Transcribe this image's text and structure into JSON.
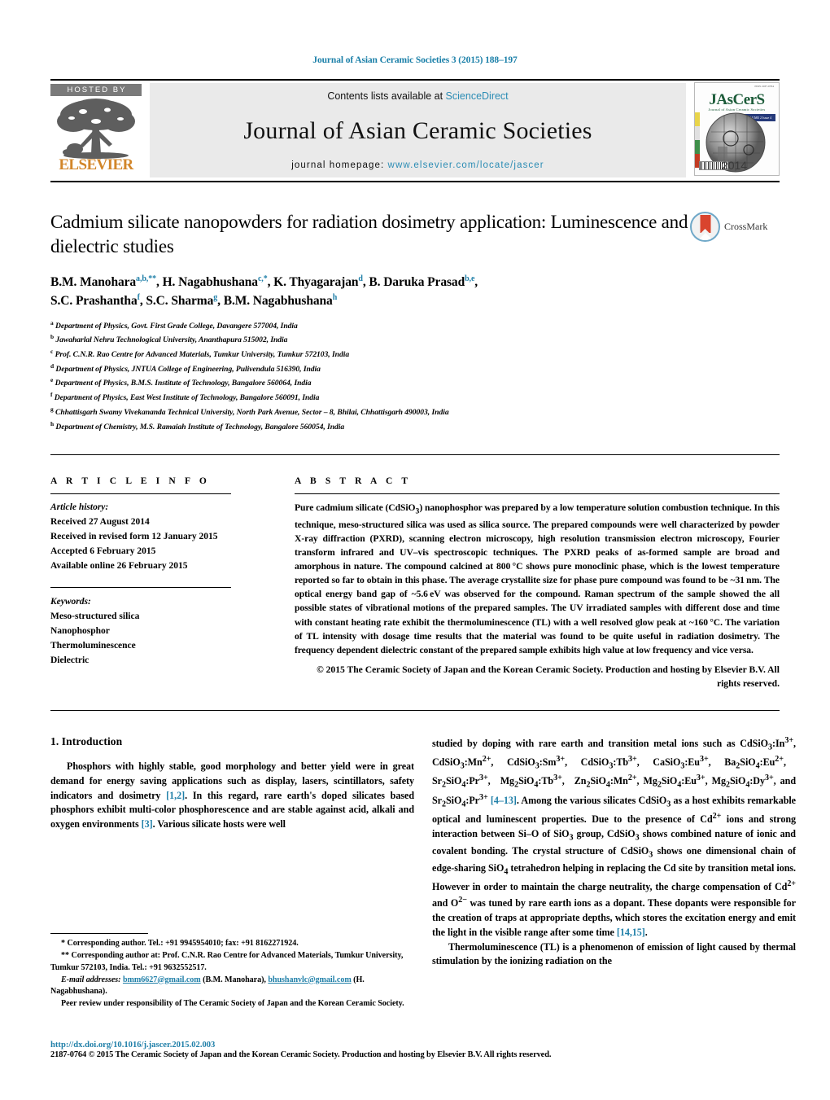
{
  "running_head": "Journal of Asian Ceramic Societies 3 (2015) 188–197",
  "masthead": {
    "hosted_by": "HOSTED BY",
    "publisher": "ELSEVIER",
    "contents_prefix": "Contents lists available at ",
    "contents_link": "ScienceDirect",
    "journal_name": "Journal of Asian Ceramic Societies",
    "homepage_prefix": "journal homepage: ",
    "homepage_url": "www.elsevier.com/locate/jascer",
    "cover": {
      "title": "JAsCerS",
      "subtitle": "Journal of Asian Ceramic Societies",
      "corner_note": "ISSN 2187-0764",
      "badge": "VOLUME 2 Issue 4",
      "year": "2014"
    }
  },
  "article": {
    "title": "Cadmium silicate nanopowders for radiation dosimetry application: Luminescence and dielectric studies",
    "crossmark_label": "CrossMark",
    "authors_line_1_html": "B.M. Manohara<sup>a,b,**</sup>, H. Nagabhushana<sup>c,*</sup>, K. Thyagarajan<sup>d</sup>, B. Daruka Prasad<sup>b,e</sup>,",
    "authors_line_2_html": "S.C. Prashantha<sup>f</sup>, S.C. Sharma<sup>g</sup>, B.M. Nagabhushana<sup>h</sup>",
    "affiliations": [
      {
        "mark": "a",
        "text": "Department of Physics, Govt. First Grade College, Davangere 577004, India"
      },
      {
        "mark": "b",
        "text": "Jawaharlal Nehru Technological University, Ananthapura 515002, India"
      },
      {
        "mark": "c",
        "text": "Prof. C.N.R. Rao Centre for Advanced Materials, Tumkur University, Tumkur 572103, India"
      },
      {
        "mark": "d",
        "text": "Department of Physics, JNTUA College of Engineering, Pulivendula 516390, India"
      },
      {
        "mark": "e",
        "text": "Department of Physics, B.M.S. Institute of Technology, Bangalore 560064, India"
      },
      {
        "mark": "f",
        "text": "Department of Physics, East West Institute of Technology, Bangalore 560091, India"
      },
      {
        "mark": "g",
        "text": "Chhattisgarh Swamy Vivekananda Technical University, North Park Avenue, Sector – 8, Bhilai, Chhattisgarh 490003, India"
      },
      {
        "mark": "h",
        "text": "Department of Chemistry, M.S. Ramaiah Institute of Technology, Bangalore 560054, India"
      }
    ]
  },
  "article_info": {
    "heading": "A R T I C L E   I N F O",
    "history_label": "Article history:",
    "history": [
      "Received 27 August 2014",
      "Received in revised form 12 January 2015",
      "Accepted 6 February 2015",
      "Available online 26 February 2015"
    ],
    "keywords_label": "Keywords:",
    "keywords": [
      "Meso-structured silica",
      "Nanophosphor",
      "Thermoluminescence",
      "Dielectric"
    ]
  },
  "abstract": {
    "heading": "A B S T R A C T",
    "body_html": "Pure cadmium silicate (CdSiO<sub>3</sub>) nanophosphor was prepared by a low temperature solution combustion technique. In this technique, meso-structured silica was used as silica source. The prepared compounds were well characterized by powder X-ray diffraction (PXRD), scanning electron microscopy, high resolution transmission electron microscopy, Fourier transform infrared and UV–vis spectroscopic techniques. The PXRD peaks of as-formed sample are broad and amorphous in nature. The compound calcined at 800&#8201;°C shows pure monoclinic phase, which is the lowest temperature reported so far to obtain in this phase. The average crystallite size for phase pure compound was found to be ~31&#8201;nm. The optical energy band gap of ~5.6&#8201;eV was observed for the compound. Raman spectrum of the sample showed the all possible states of vibrational motions of the prepared samples. The UV irradiated samples with different dose and time with constant heating rate exhibit the thermoluminescence (TL) with a well resolved glow peak at ~160&#8201;°C. The variation of TL intensity with dosage time results that the material was found to be quite useful in radiation dosimetry. The frequency dependent dielectric constant of the prepared sample exhibits high value at low frequency and vice versa.",
    "copyright": "© 2015 The Ceramic Society of Japan and the Korean Ceramic Society. Production and hosting by Elsevier B.V. All rights reserved."
  },
  "introduction": {
    "heading": "1.  Introduction",
    "left_para_html": "Phosphors with highly stable, good morphology and better yield were in great demand for energy saving applications such as display, lasers, scintillators, safety indicators and dosimetry <span class=\"ref\">[1,2]</span>. In this regard, rare earth's doped silicates based phosphors exhibit multi-color phosphorescence and are stable against acid, alkali and oxygen environments <span class=\"ref\">[3]</span>. Various silicate hosts were well",
    "right_para_1_html": "studied by doping with rare earth and transition metal ions such as CdSiO<sub>3</sub>:In<sup>3+</sup>, CdSiO<sub>3</sub>:Mn<sup>2+</sup>, CdSiO<sub>3</sub>:Sm<sup>3+</sup>, CdSiO<sub>3</sub>:Tb<sup>3+</sup>, CaSiO<sub>3</sub>:Eu<sup>3+</sup>, Ba<sub>2</sub>SiO<sub>4</sub>:Eu<sup>2+</sup>,&#8195;Sr<sub>2</sub>SiO<sub>4</sub>:Pr<sup>3+</sup>,&#8195;Mg<sub>2</sub>SiO<sub>4</sub>:Tb<sup>3+</sup>,&#8195;Zn<sub>2</sub>SiO<sub>4</sub>:Mn<sup>2+</sup>, Mg<sub>2</sub>SiO<sub>4</sub>:Eu<sup>3+</sup>, Mg<sub>2</sub>SiO<sub>4</sub>:Dy<sup>3+</sup>, and Sr<sub>2</sub>SiO<sub>4</sub>:Pr<sup>3+</sup> <span class=\"ref\">[4–13]</span>. Among the various silicates CdSiO<sub>3</sub> as a host exhibits remarkable optical and luminescent properties. Due to the presence of Cd<sup>2+</sup> ions and strong interaction between Si–O of SiO<sub>3</sub> group, CdSiO<sub>3</sub> shows combined nature of ionic and covalent bonding. The crystal structure of CdSiO<sub>3</sub> shows one dimensional chain of edge-sharing SiO<sub>4</sub> tetrahedron helping in replacing the Cd site by transition metal ions. However in order to maintain the charge neutrality, the charge compensation of Cd<sup>2+</sup> and O<sup>2−</sup> was tuned by rare earth ions as a dopant. These dopants were responsible for the creation of traps at appropriate depths, which stores the excitation energy and emit the light in the visible range after some time <span class=\"ref\">[14,15]</span>.",
    "right_para_2_html": "Thermoluminescence (TL) is a phenomenon of emission of light caused by thermal stimulation by the ionizing radiation on the"
  },
  "footnotes": {
    "corresponding_1": "*  Corresponding author. Tel.: +91 9945954010; fax: +91 8162271924.",
    "corresponding_2": "**  Corresponding author at: Prof. C.N.R. Rao Centre for Advanced Materials, Tumkur University, Tumkur 572103, India. Tel.: +91 9632552517.",
    "email_label": "E-mail addresses:",
    "email_1": "bmm6627@gmail.com",
    "email_1_owner": "(B.M. Manohara),",
    "email_2": "bhushanvlc@gmail.com",
    "email_2_owner": "(H. Nagabhushana).",
    "peer_review": "Peer review under responsibility of The Ceramic Society of Japan and the Korean Ceramic Society."
  },
  "page_footer": {
    "doi": "http://dx.doi.org/10.1016/j.jascer.2015.02.003",
    "issn_line": "2187-0764 © 2015 The Ceramic Society of Japan and the Korean Ceramic Society. Production and hosting by Elsevier B.V. All rights reserved."
  },
  "colors": {
    "link": "#1f7fa8",
    "elsevier_orange": "#d2862a",
    "cover_green": "#1d5c3a",
    "crossmark_red": "#d9442e"
  }
}
